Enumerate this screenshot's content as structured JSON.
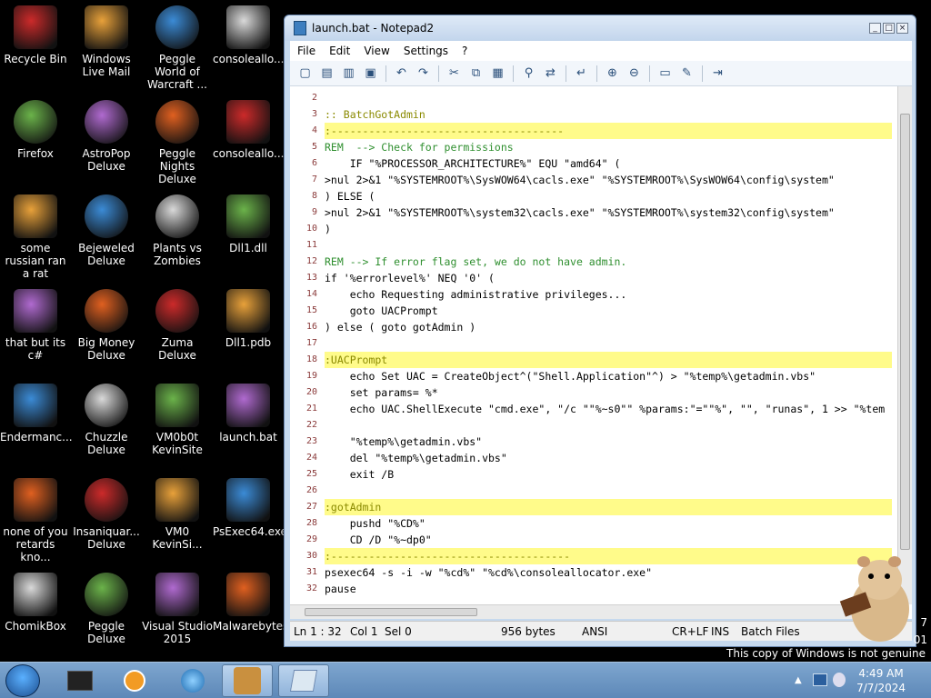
{
  "desktop": {
    "icons": [
      {
        "label": "Recycle Bin",
        "icon": "recycle-bin-icon"
      },
      {
        "label": "Windows Live Mail",
        "icon": "mail-icon"
      },
      {
        "label": "Peggle World of Warcraft ...",
        "icon": "game-icon"
      },
      {
        "label": "consoleallo...",
        "icon": "console-icon"
      },
      {
        "label": "Firefox",
        "icon": "firefox-icon"
      },
      {
        "label": "AstroPop Deluxe",
        "icon": "game-icon"
      },
      {
        "label": "Peggle Nights Deluxe",
        "icon": "game-icon"
      },
      {
        "label": "consoleallo...",
        "icon": "file-icon"
      },
      {
        "label": "some russian ran a rat",
        "icon": "app-icon"
      },
      {
        "label": "Bejeweled Deluxe",
        "icon": "game-icon"
      },
      {
        "label": "Plants vs Zombies",
        "icon": "game-icon"
      },
      {
        "label": "Dll1.dll",
        "icon": "dll-icon"
      },
      {
        "label": "that but its c#",
        "icon": "shortcut-icon"
      },
      {
        "label": "Big Money Deluxe",
        "icon": "game-icon"
      },
      {
        "label": "Zuma Deluxe",
        "icon": "game-icon"
      },
      {
        "label": "Dll1.pdb",
        "icon": "file-icon"
      },
      {
        "label": "Endermanc...",
        "icon": "app-icon"
      },
      {
        "label": "Chuzzle Deluxe",
        "icon": "game-icon"
      },
      {
        "label": "VM0b0t KevinSite",
        "icon": "app-icon"
      },
      {
        "label": "launch.bat",
        "icon": "batch-icon"
      },
      {
        "label": "none of you retards kno...",
        "icon": "app-icon"
      },
      {
        "label": "Insaniquar... Deluxe",
        "icon": "game-icon"
      },
      {
        "label": "VM0 KevinSi...",
        "icon": "app-icon"
      },
      {
        "label": "PsExec64.exe",
        "icon": "console-icon"
      },
      {
        "label": "ChomikBox",
        "icon": "app-icon"
      },
      {
        "label": "Peggle Deluxe",
        "icon": "game-icon"
      },
      {
        "label": "Visual Studio 2015",
        "icon": "visual-studio-icon"
      },
      {
        "label": "Malwarebytes",
        "icon": "malwarebytes-icon"
      }
    ]
  },
  "window": {
    "title": "launch.bat - Notepad2",
    "menu": [
      "File",
      "Edit",
      "View",
      "Settings",
      "?"
    ],
    "lines": [
      {
        "n": "2",
        "t": "",
        "hl": false
      },
      {
        "n": "3",
        "t": ":: BatchGotAdmin",
        "hl": false
      },
      {
        "n": "4",
        "t": ":-------------------------------------",
        "hl": true
      },
      {
        "n": "5",
        "t": "REM  --> Check for permissions",
        "hl": false
      },
      {
        "n": "6",
        "t": "    IF \"%PROCESSOR_ARCHITECTURE%\" EQU \"amd64\" (",
        "hl": false
      },
      {
        "n": "7",
        "t": ">nul 2>&1 \"%SYSTEMROOT%\\SysWOW64\\cacls.exe\" \"%SYSTEMROOT%\\SysWOW64\\config\\system\"",
        "hl": false
      },
      {
        "n": "8",
        "t": ") ELSE (",
        "hl": false
      },
      {
        "n": "9",
        "t": ">nul 2>&1 \"%SYSTEMROOT%\\system32\\cacls.exe\" \"%SYSTEMROOT%\\system32\\config\\system\"",
        "hl": false
      },
      {
        "n": "10",
        "t": ")",
        "hl": false
      },
      {
        "n": "11",
        "t": "",
        "hl": false
      },
      {
        "n": "12",
        "t": "REM --> If error flag set, we do not have admin.",
        "hl": false
      },
      {
        "n": "13",
        "t": "if '%errorlevel%' NEQ '0' (",
        "hl": false
      },
      {
        "n": "14",
        "t": "    echo Requesting administrative privileges...",
        "hl": false
      },
      {
        "n": "15",
        "t": "    goto UACPrompt",
        "hl": false
      },
      {
        "n": "16",
        "t": ") else ( goto gotAdmin )",
        "hl": false
      },
      {
        "n": "17",
        "t": "",
        "hl": false
      },
      {
        "n": "18",
        "t": ":UACPrompt",
        "hl": true
      },
      {
        "n": "19",
        "t": "    echo Set UAC = CreateObject^(\"Shell.Application\"^) > \"%temp%\\getadmin.vbs\"",
        "hl": false
      },
      {
        "n": "20",
        "t": "    set params= %*",
        "hl": false
      },
      {
        "n": "21",
        "t": "    echo UAC.ShellExecute \"cmd.exe\", \"/c \"\"%~s0\"\" %params:\"=\"\"%\", \"\", \"runas\", 1 >> \"%tem",
        "hl": false
      },
      {
        "n": "22",
        "t": "",
        "hl": false
      },
      {
        "n": "23",
        "t": "    \"%temp%\\getadmin.vbs\"",
        "hl": false
      },
      {
        "n": "24",
        "t": "    del \"%temp%\\getadmin.vbs\"",
        "hl": false
      },
      {
        "n": "25",
        "t": "    exit /B",
        "hl": false
      },
      {
        "n": "26",
        "t": "",
        "hl": false
      },
      {
        "n": "27",
        "t": ":gotAdmin",
        "hl": true
      },
      {
        "n": "28",
        "t": "    pushd \"%CD%\"",
        "hl": false
      },
      {
        "n": "29",
        "t": "    CD /D \"%~dp0\"",
        "hl": false
      },
      {
        "n": "30",
        "t": ":--------------------------------------",
        "hl": true
      },
      {
        "n": "31",
        "t": "psexec64 -s -i -w \"%cd%\" \"%cd%\\consoleallocator.exe\"",
        "hl": false
      },
      {
        "n": "32",
        "t": "pause",
        "hl": false
      }
    ],
    "status": {
      "position": "Ln 1 : 32",
      "col": "Col 1",
      "sel": "Sel 0",
      "size": "956 bytes",
      "encoding": "ANSI",
      "eol": "CR+LF",
      "ins": "INS",
      "scheme": "Batch Files"
    }
  },
  "taskbar": {
    "time": "4:49 AM",
    "date": "7/7/2024",
    "genuine_notice": "This copy of Windows is not genuine",
    "edge_clock_top": "7",
    "edge_clock_bottom": "01"
  },
  "colors": {
    "highlight_line": "#fffb8a",
    "line_number": "#8a3a3a",
    "label_text": "#8a8a00",
    "comment_text": "#2f8f2f"
  }
}
